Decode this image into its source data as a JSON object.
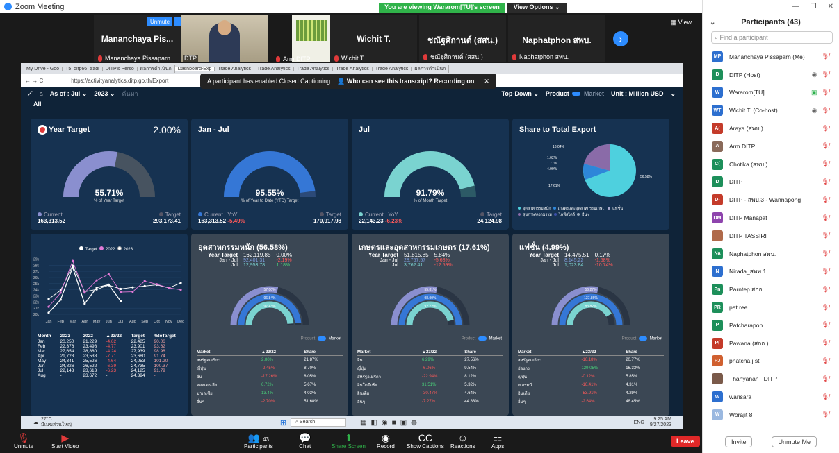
{
  "window": {
    "title": "Zoom Meeting"
  },
  "share_banner": {
    "text": "You are viewing Wararom[TU]'s screen",
    "view_options": "View Options"
  },
  "view_button": "View",
  "thumbs": [
    {
      "name": "Mananchaya Pis...",
      "label": "Mananchaya Pissaparn"
    },
    {
      "name": "",
      "label": "DTP"
    },
    {
      "name": "",
      "label": "Arm DITP"
    },
    {
      "name": "Wichit T.",
      "label": "Wichit T."
    },
    {
      "name": "ชณัฐศิกานต์ (สสน.)",
      "label": "ชณัฐศิกานต์ (สสน.)"
    },
    {
      "name": "Naphatphon สพบ.",
      "label": "Naphatphon สพบ."
    }
  ],
  "unmute_pop": "Unmute",
  "browser": {
    "tabs": [
      "My Drive - Goo",
      "T5_ditp66_tradi",
      "DITP's Perso",
      "ผลการดำเนินก",
      "Dashboard-Exp",
      "Trade Analytics",
      "Trade Analytics",
      "Trade Analytics",
      "Trade Analytics",
      "Trade Analytics",
      "ผลการดำเนินก"
    ],
    "url": "https://activityanalytics.ditp.go.th/Export",
    "cc_toast": "A participant has enabled Closed Captioning",
    "cc_toast_bold": "Who can see this transcript? Recording on"
  },
  "filter": {
    "as_of": "As of : Jul",
    "year": "2023",
    "placeholder": "ค้นหา",
    "topdown": "Top-Down",
    "product": "Product",
    "market": "Market",
    "unit": "Unit : Million USD",
    "all": "All"
  },
  "cards": {
    "year_target": {
      "title": "Year Target",
      "pct_top": "2.00%",
      "gauge": "55.71%",
      "gauge_sub": "% of Year Target",
      "gauge_value": 0.5571,
      "current_label": "Current",
      "target_label": "Target",
      "current": "163,313.52",
      "target": "293,173.41"
    },
    "jan_jul": {
      "title": "Jan - Jul",
      "gauge": "95.55%",
      "gauge_sub": "% of Year to Date (YTD) Target",
      "gauge_value": 0.9555,
      "current_label": "Current",
      "yoy_label": "YoY",
      "target_label": "Target",
      "current": "163,313.52",
      "yoy": "-5.49%",
      "target": "170,917.98"
    },
    "jul": {
      "title": "Jul",
      "gauge": "91.79%",
      "gauge_sub": "% of Month Target",
      "gauge_value": 0.9179,
      "current_label": "Current",
      "yoy_label": "YoY",
      "target_label": "Target",
      "current": "22,143.23",
      "yoy": "-6.23%",
      "target": "24,124.98"
    },
    "share": {
      "title": "Share to Total Export",
      "labels": [
        "18.04%",
        "1.02%",
        "1.77%",
        "4.99%",
        "17.61%",
        "56.58%"
      ],
      "legend": [
        "อุตสาหกรรมหนัก",
        "เกษตรและอุตสาหกรรมเกษ...",
        "แฟชั่น",
        "สุขภาพ/ความงาม",
        "ไลฟ์สไตล์",
        "อื่นๆ"
      ]
    }
  },
  "chart_data": {
    "type": "line",
    "categories": [
      "Jan",
      "Feb",
      "Mar",
      "Apr",
      "May",
      "Jun",
      "Jul",
      "Aug",
      "Sep",
      "Oct",
      "Nov",
      "Dec"
    ],
    "legend": [
      "Target",
      "2022",
      "2023"
    ],
    "y_ticks": [
      "29k",
      "28k",
      "27k",
      "26k",
      "25k",
      "24k",
      "23k",
      "22k",
      "21k",
      "20k"
    ],
    "ylim": [
      20,
      29.5
    ],
    "series": [
      {
        "name": "Target",
        "values": [
          22.49,
          23.9,
          27.94,
          23.68,
          24.05,
          24.74,
          24.13,
          24.39,
          24.6,
          24.8,
          24.3,
          25.1
        ]
      },
      {
        "name": "2022",
        "values": [
          21.23,
          23.5,
          28.69,
          23.54,
          25.53,
          26.52,
          23.61,
          23.67,
          25.4,
          24.9,
          24.3,
          24.0
        ]
      },
      {
        "name": "2023",
        "values": [
          20.25,
          22.38,
          27.65,
          21.72,
          24.34,
          24.83,
          22.14
        ]
      }
    ]
  },
  "month_table": {
    "headers": [
      "Month",
      "2023",
      "2022",
      "▲23/22",
      "Target",
      "%toTarget"
    ],
    "rows": [
      [
        "Jan",
        "20,250",
        "21,229",
        "-4.62",
        "22,485",
        "90.06"
      ],
      [
        "Feb",
        "22,376",
        "23,498",
        "-4.77",
        "23,901",
        "93.62"
      ],
      [
        "Mar",
        "27,654",
        "28,880",
        "-4.24",
        "27,939",
        "98.98"
      ],
      [
        "Apr",
        "21,723",
        "23,538",
        "-7.71",
        "23,680",
        "91.74"
      ],
      [
        "May",
        "24,341",
        "25,526",
        "-4.64",
        "24,053",
        "101.20"
      ],
      [
        "Jun",
        "24,826",
        "26,522",
        "-6.39",
        "24,735",
        "100.37"
      ],
      [
        "Jul",
        "22,143",
        "23,613",
        "-6.23",
        "24,125",
        "91.79"
      ],
      [
        "Aug",
        "-",
        "23,672",
        "-",
        "24,394",
        "-"
      ]
    ]
  },
  "sectors": [
    {
      "title": "อุตสาหกรรมหนัก (56.58%)",
      "year_target_label": "Year Target",
      "year_target": "162,119.85",
      "year_pct": "0.00%",
      "janjul_label": "Jan - Jul",
      "janjul": "92,401.31",
      "janjul_pct": "-2.19%",
      "jul_label": "Jul",
      "jul": "12,953.78",
      "jul_pct": "1.18%",
      "rings": [
        "57.00%",
        "96.84%",
        "97.43%"
      ],
      "toggle_a": "Product",
      "toggle_b": "Market",
      "headers": [
        "Market",
        "▲23/22",
        "Share"
      ],
      "rows": [
        [
          "สหรัฐอเมริกา",
          "2.80%",
          "21.87%"
        ],
        [
          "ญี่ปุ่น",
          "-2.45%",
          "8.70%"
        ],
        [
          "จีน",
          "-17.26%",
          "8.05%"
        ],
        [
          "ออสเตรเลีย",
          "6.72%",
          "5.67%"
        ],
        [
          "มาเลเซีย",
          "13.4%",
          "4.03%"
        ],
        [
          "อื่นๆ",
          "-2.70%",
          "51.68%"
        ]
      ]
    },
    {
      "title": "เกษตรและอุตสาหกรรมเกษตร (17.61%)",
      "year_target_label": "Year Target",
      "year_target": "51,815.85",
      "year_pct": "5.84%",
      "janjul_label": "Jan - Jul",
      "janjul": "28,757.57",
      "janjul_pct": "-5.68%",
      "jul_label": "Jul",
      "jul": "3,762.41",
      "jul_pct": "-12.59%",
      "rings": [
        "55.81%",
        "98.90%",
        "92.72%"
      ],
      "toggle_a": "Product",
      "toggle_b": "Market",
      "headers": [
        "Market",
        "▲23/22",
        "Share"
      ],
      "rows": [
        [
          "จีน",
          "6.29%",
          "27.56%"
        ],
        [
          "ญี่ปุ่น",
          "-6.06%",
          "9.54%"
        ],
        [
          "สหรัฐอเมริกา",
          "-22.94%",
          "8.12%"
        ],
        [
          "อินโดนีเซีย",
          "31.51%",
          "5.32%"
        ],
        [
          "อินเดีย",
          "-30.47%",
          "4.64%"
        ],
        [
          "อื่นๆ",
          "-7.27%",
          "44.83%"
        ]
      ]
    },
    {
      "title": "แฟชั่น (4.99%)",
      "year_target_label": "Year Target",
      "year_target": "14,475.51",
      "year_pct": "0.17%",
      "janjul_label": "Jan - Jul",
      "janjul": "8,145.22",
      "janjul_pct": "-1.58%",
      "jul_label": "Jul",
      "jul": "1,023.84",
      "jul_pct": "-10.74%",
      "rings": [
        "56.27%",
        "137.86%",
        "83.82%"
      ],
      "toggle_a": "Product",
      "toggle_b": "Market",
      "headers": [
        "Market",
        "▲23/22",
        "Share"
      ],
      "rows": [
        [
          "สหรัฐอเมริกา",
          "-16.18%",
          "20.77%"
        ],
        [
          "ฮ่องกง",
          "129.05%",
          "16.33%"
        ],
        [
          "ญี่ปุ่น",
          "-0.12%",
          "5.85%"
        ],
        [
          "เยอรมนี",
          "-16.41%",
          "4.31%"
        ],
        [
          "อินเดีย",
          "-53.91%",
          "4.29%"
        ],
        [
          "อื่นๆ",
          "-2.64%",
          "48.45%"
        ]
      ]
    }
  ],
  "taskbar": {
    "weather": "27°C",
    "weather_sub": "มีเมฆส่วนใหญ่",
    "search": "Search",
    "lang": "ENG",
    "time": "9:25 AM",
    "date": "9/27/2023"
  },
  "toolbar": {
    "unmute": "Unmute",
    "start_video": "Start Video",
    "participants": "Participants",
    "participants_count": "43",
    "chat": "Chat",
    "share": "Share Screen",
    "record": "Record",
    "captions": "Show Captions",
    "reactions": "Reactions",
    "apps": "Apps",
    "leave": "Leave"
  },
  "panel": {
    "title": "Participants (43)",
    "search_placeholder": "Find a participant",
    "invite": "Invite",
    "unmute_me": "Unmute Me",
    "participants": [
      {
        "initials": "MP",
        "name": "Mananchaya Pissaparn (Me)",
        "color": "#2d6fcf"
      },
      {
        "initials": "D",
        "name": "DITP (Host)",
        "color": "#1d8f5a"
      },
      {
        "initials": "W",
        "name": "Wararom[TU]",
        "color": "#2d6fcf"
      },
      {
        "initials": "WT",
        "name": "Wichit T. (Co-host)",
        "color": "#2d6fcf"
      },
      {
        "initials": "A(",
        "name": "Araya (สพบ.)",
        "color": "#c43b2a"
      },
      {
        "initials": "A",
        "name": "Arm DITP",
        "color": "#8a6a5a"
      },
      {
        "initials": "C(",
        "name": "Chotika (สพบ.)",
        "color": "#1d8f5a"
      },
      {
        "initials": "D",
        "name": "DITP",
        "color": "#1d8f5a"
      },
      {
        "initials": "D-",
        "name": "DITP - สพบ.3 - Wannapong",
        "color": "#c43b2a"
      },
      {
        "initials": "DM",
        "name": "DITP Manapat",
        "color": "#8e44ad"
      },
      {
        "initials": "",
        "name": "DITP TASSIRI",
        "color": "#b06a4a"
      },
      {
        "initials": "Na",
        "name": "Naphatphon สพบ.",
        "color": "#1d8f5a"
      },
      {
        "initials": "N",
        "name": "Nirada_สพพ.1",
        "color": "#2d6fcf"
      },
      {
        "initials": "Pn",
        "name": "Parntep สกอ.",
        "color": "#1d8f5a"
      },
      {
        "initials": "PR",
        "name": "pat ree",
        "color": "#1d8f5a"
      },
      {
        "initials": "P",
        "name": "Patcharapon",
        "color": "#1d8f5a"
      },
      {
        "initials": "P(",
        "name": "Pawana (สกอ.)",
        "color": "#c43b2a"
      },
      {
        "initials": "PJ",
        "name": "phatcha j stl",
        "color": "#d06030"
      },
      {
        "initials": "",
        "name": "Thanyanan _DITP",
        "color": "#7a5a4a"
      },
      {
        "initials": "W",
        "name": "warisara",
        "color": "#2d6fcf"
      },
      {
        "initials": "W",
        "name": "Worajit 8",
        "color": "#9ab8e0"
      }
    ]
  }
}
